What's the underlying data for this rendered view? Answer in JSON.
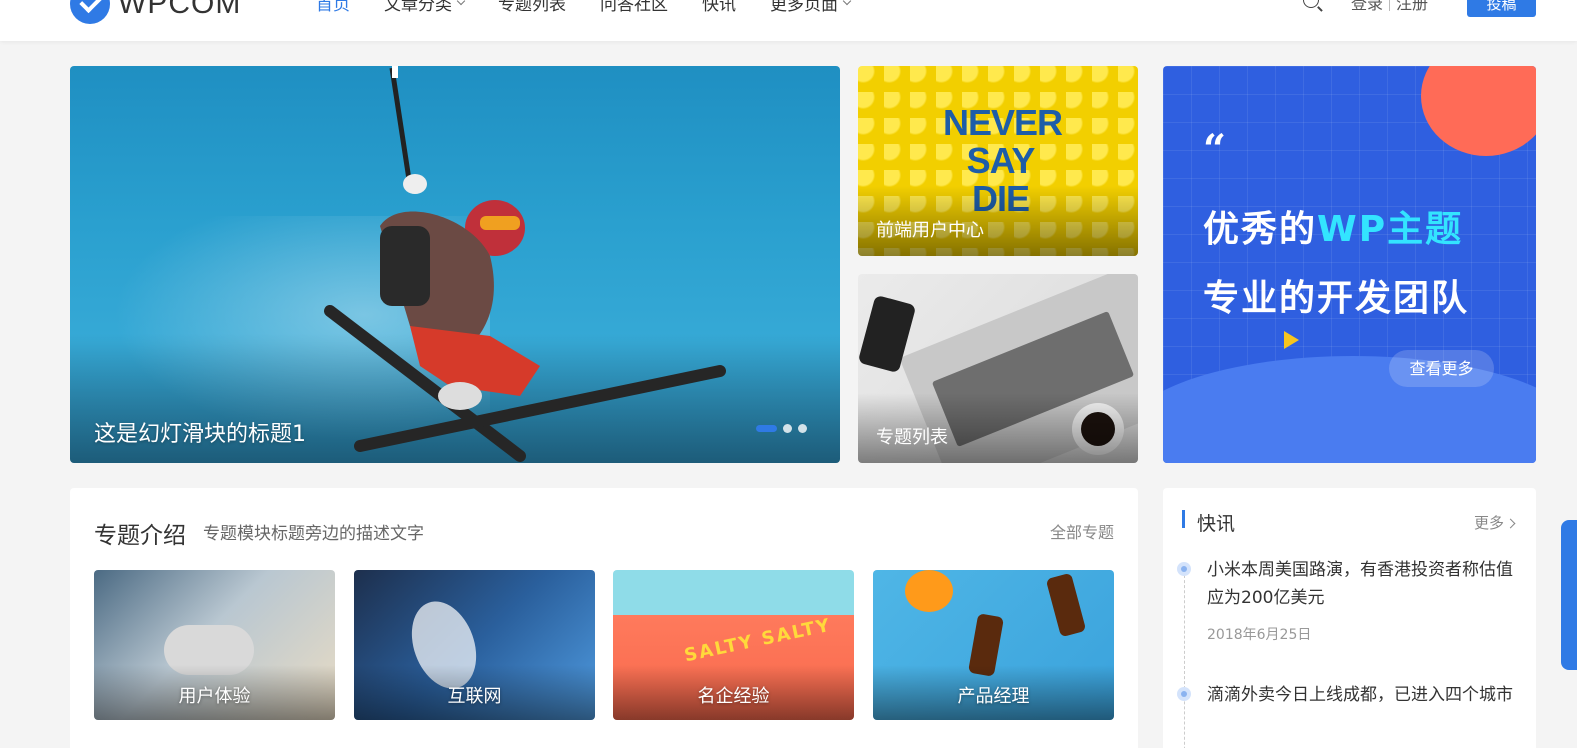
{
  "header": {
    "logo_text": "WPCOM",
    "nav": [
      {
        "label": "首页",
        "active": true,
        "dropdown": false
      },
      {
        "label": "文章分类",
        "active": false,
        "dropdown": true
      },
      {
        "label": "专题列表",
        "active": false,
        "dropdown": false
      },
      {
        "label": "问答社区",
        "active": false,
        "dropdown": false
      },
      {
        "label": "快讯",
        "active": false,
        "dropdown": false
      },
      {
        "label": "更多页面",
        "active": false,
        "dropdown": true
      }
    ],
    "login": "登录",
    "register": "注册",
    "post_button": "投稿",
    "accent_color": "#2f7ae5"
  },
  "slider": {
    "title": "这是幻灯滑块的标题1",
    "slide_count": 3,
    "active_index": 0
  },
  "features": [
    {
      "label": "前端用户中心",
      "image_text": "NEVER SAY DIE"
    },
    {
      "label": "专题列表"
    }
  ],
  "promo": {
    "quote": "“",
    "line1_a": "优秀的",
    "line1_b": "WP主题",
    "line2": "专业的开发团队",
    "button": "查看更多"
  },
  "topics": {
    "title": "专题介绍",
    "description": "专题模块标题旁边的描述文字",
    "all_link": "全部专题",
    "items": [
      {
        "label": "用户体验"
      },
      {
        "label": "互联网"
      },
      {
        "label": "名企经验",
        "image_text": "SALTY SALTY"
      },
      {
        "label": "产品经理"
      }
    ]
  },
  "news": {
    "title": "快讯",
    "more": "更多",
    "items": [
      {
        "text": "小米本周美国路演，有香港投资者称估值应为200亿美元",
        "date": "2018年6月25日"
      },
      {
        "text": "滴滴外卖今日上线成都，已进入四个城市"
      }
    ]
  }
}
